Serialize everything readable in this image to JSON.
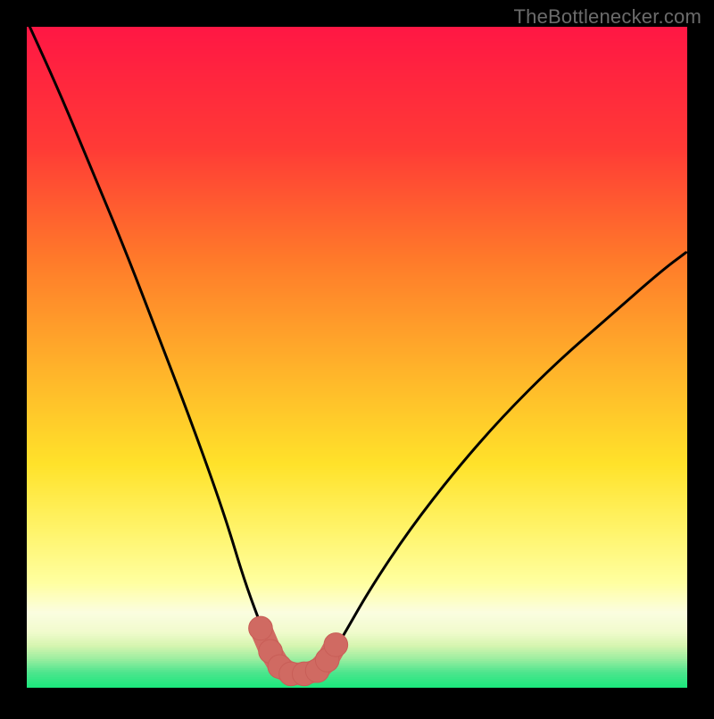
{
  "watermark": "TheBottlenecker.com",
  "colors": {
    "gradient_top": "#ff1744",
    "gradient_mid1": "#ff6a2a",
    "gradient_mid2": "#ffd62a",
    "gradient_mid3": "#fff176",
    "gradient_mid4": "#ffffa0",
    "gradient_band": "#fbfde0",
    "gradient_green_light": "#c6f5aa",
    "gradient_green": "#17e87b",
    "curve": "#000000",
    "marker_fill": "#d06a62",
    "marker_stroke": "#c85e57"
  },
  "chart_data": {
    "type": "line",
    "title": "",
    "xlabel": "",
    "ylabel": "",
    "xlim": [
      0,
      100
    ],
    "ylim": [
      0,
      100
    ],
    "series": [
      {
        "name": "bottleneck-curve",
        "x": [
          0,
          5,
          10,
          15,
          20,
          25,
          30,
          33,
          36,
          38,
          40,
          42,
          45,
          48,
          52,
          58,
          65,
          72,
          80,
          88,
          96,
          100
        ],
        "y": [
          101,
          90,
          78,
          66,
          53,
          40,
          26,
          16,
          8,
          3,
          1,
          1,
          3,
          8,
          15,
          24,
          33,
          41,
          49,
          56,
          63,
          66
        ]
      }
    ],
    "markers": [
      {
        "x": 35.4,
        "y": 9.0
      },
      {
        "x": 36.9,
        "y": 5.5
      },
      {
        "x": 38.3,
        "y": 3.2
      },
      {
        "x": 40.0,
        "y": 2.1
      },
      {
        "x": 42.0,
        "y": 2.1
      },
      {
        "x": 44.0,
        "y": 2.6
      },
      {
        "x": 45.5,
        "y": 4.2
      },
      {
        "x": 46.8,
        "y": 6.5
      }
    ],
    "marker_radius": 1.8
  }
}
